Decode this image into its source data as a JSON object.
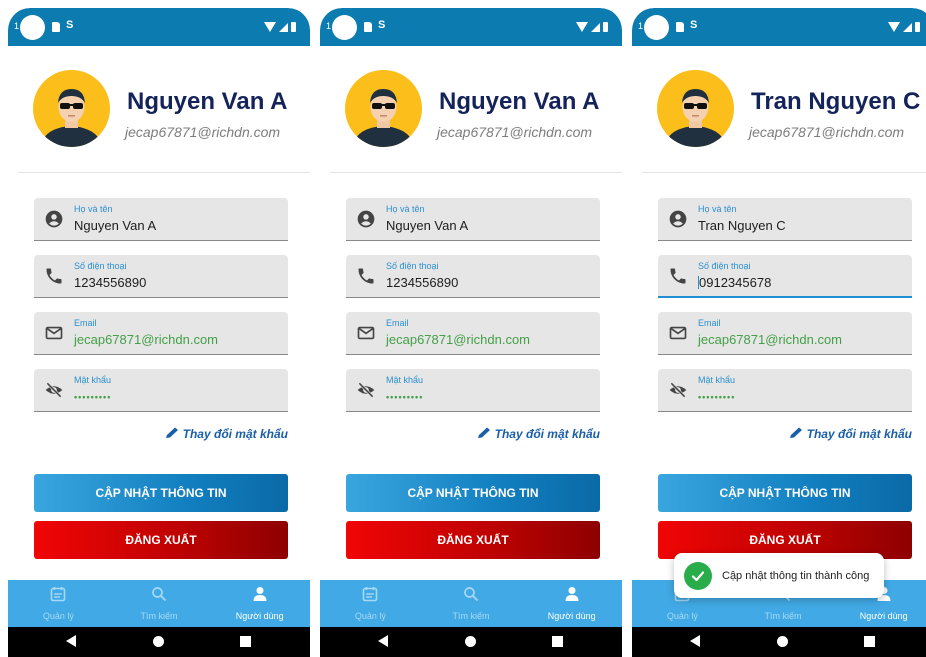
{
  "colors": {
    "status_bar": "#0b7bb0",
    "name": "#14245a",
    "accent_blue": "#2b8fcf",
    "email_green": "#43a047",
    "update_button": "#1a86c6",
    "logout_button": "#cc0202",
    "bottom_nav": "#41a9e5"
  },
  "status_bar": {
    "number": "1",
    "extra_icon": "S"
  },
  "labels": {
    "name_label": "Họ và tên",
    "phone_label": "Số điện thoại",
    "email_label": "Email",
    "password_label": "Mật khẩu",
    "change_password": "Thay đổi mật khẩu",
    "update_button": "CẬP NHẬT THÔNG TIN",
    "logout_button": "ĐĂNG XUẤT"
  },
  "nav": {
    "manage": "Quản lý",
    "search": "Tìm kiếm",
    "user": "Người dùng"
  },
  "screens": [
    {
      "name": "Nguyen Van A",
      "email": "jecap67871@richdn.com",
      "fields": {
        "full_name": "Nguyen Van A",
        "phone": "1234556890",
        "email": "jecap67871@richdn.com",
        "password": "•••••••••"
      }
    },
    {
      "name": "Nguyen Van A",
      "email": "jecap67871@richdn.com",
      "fields": {
        "full_name": "Nguyen Van A",
        "phone": "1234556890",
        "email": "jecap67871@richdn.com",
        "password": "•••••••••"
      }
    },
    {
      "name": "Tran Nguyen C",
      "email": "jecap67871@richdn.com",
      "fields": {
        "full_name": "Tran Nguyen C",
        "phone": "0912345678",
        "email": "jecap67871@richdn.com",
        "password": "•••••••••"
      },
      "toast": "Cập nhật thông tin thành công"
    }
  ]
}
